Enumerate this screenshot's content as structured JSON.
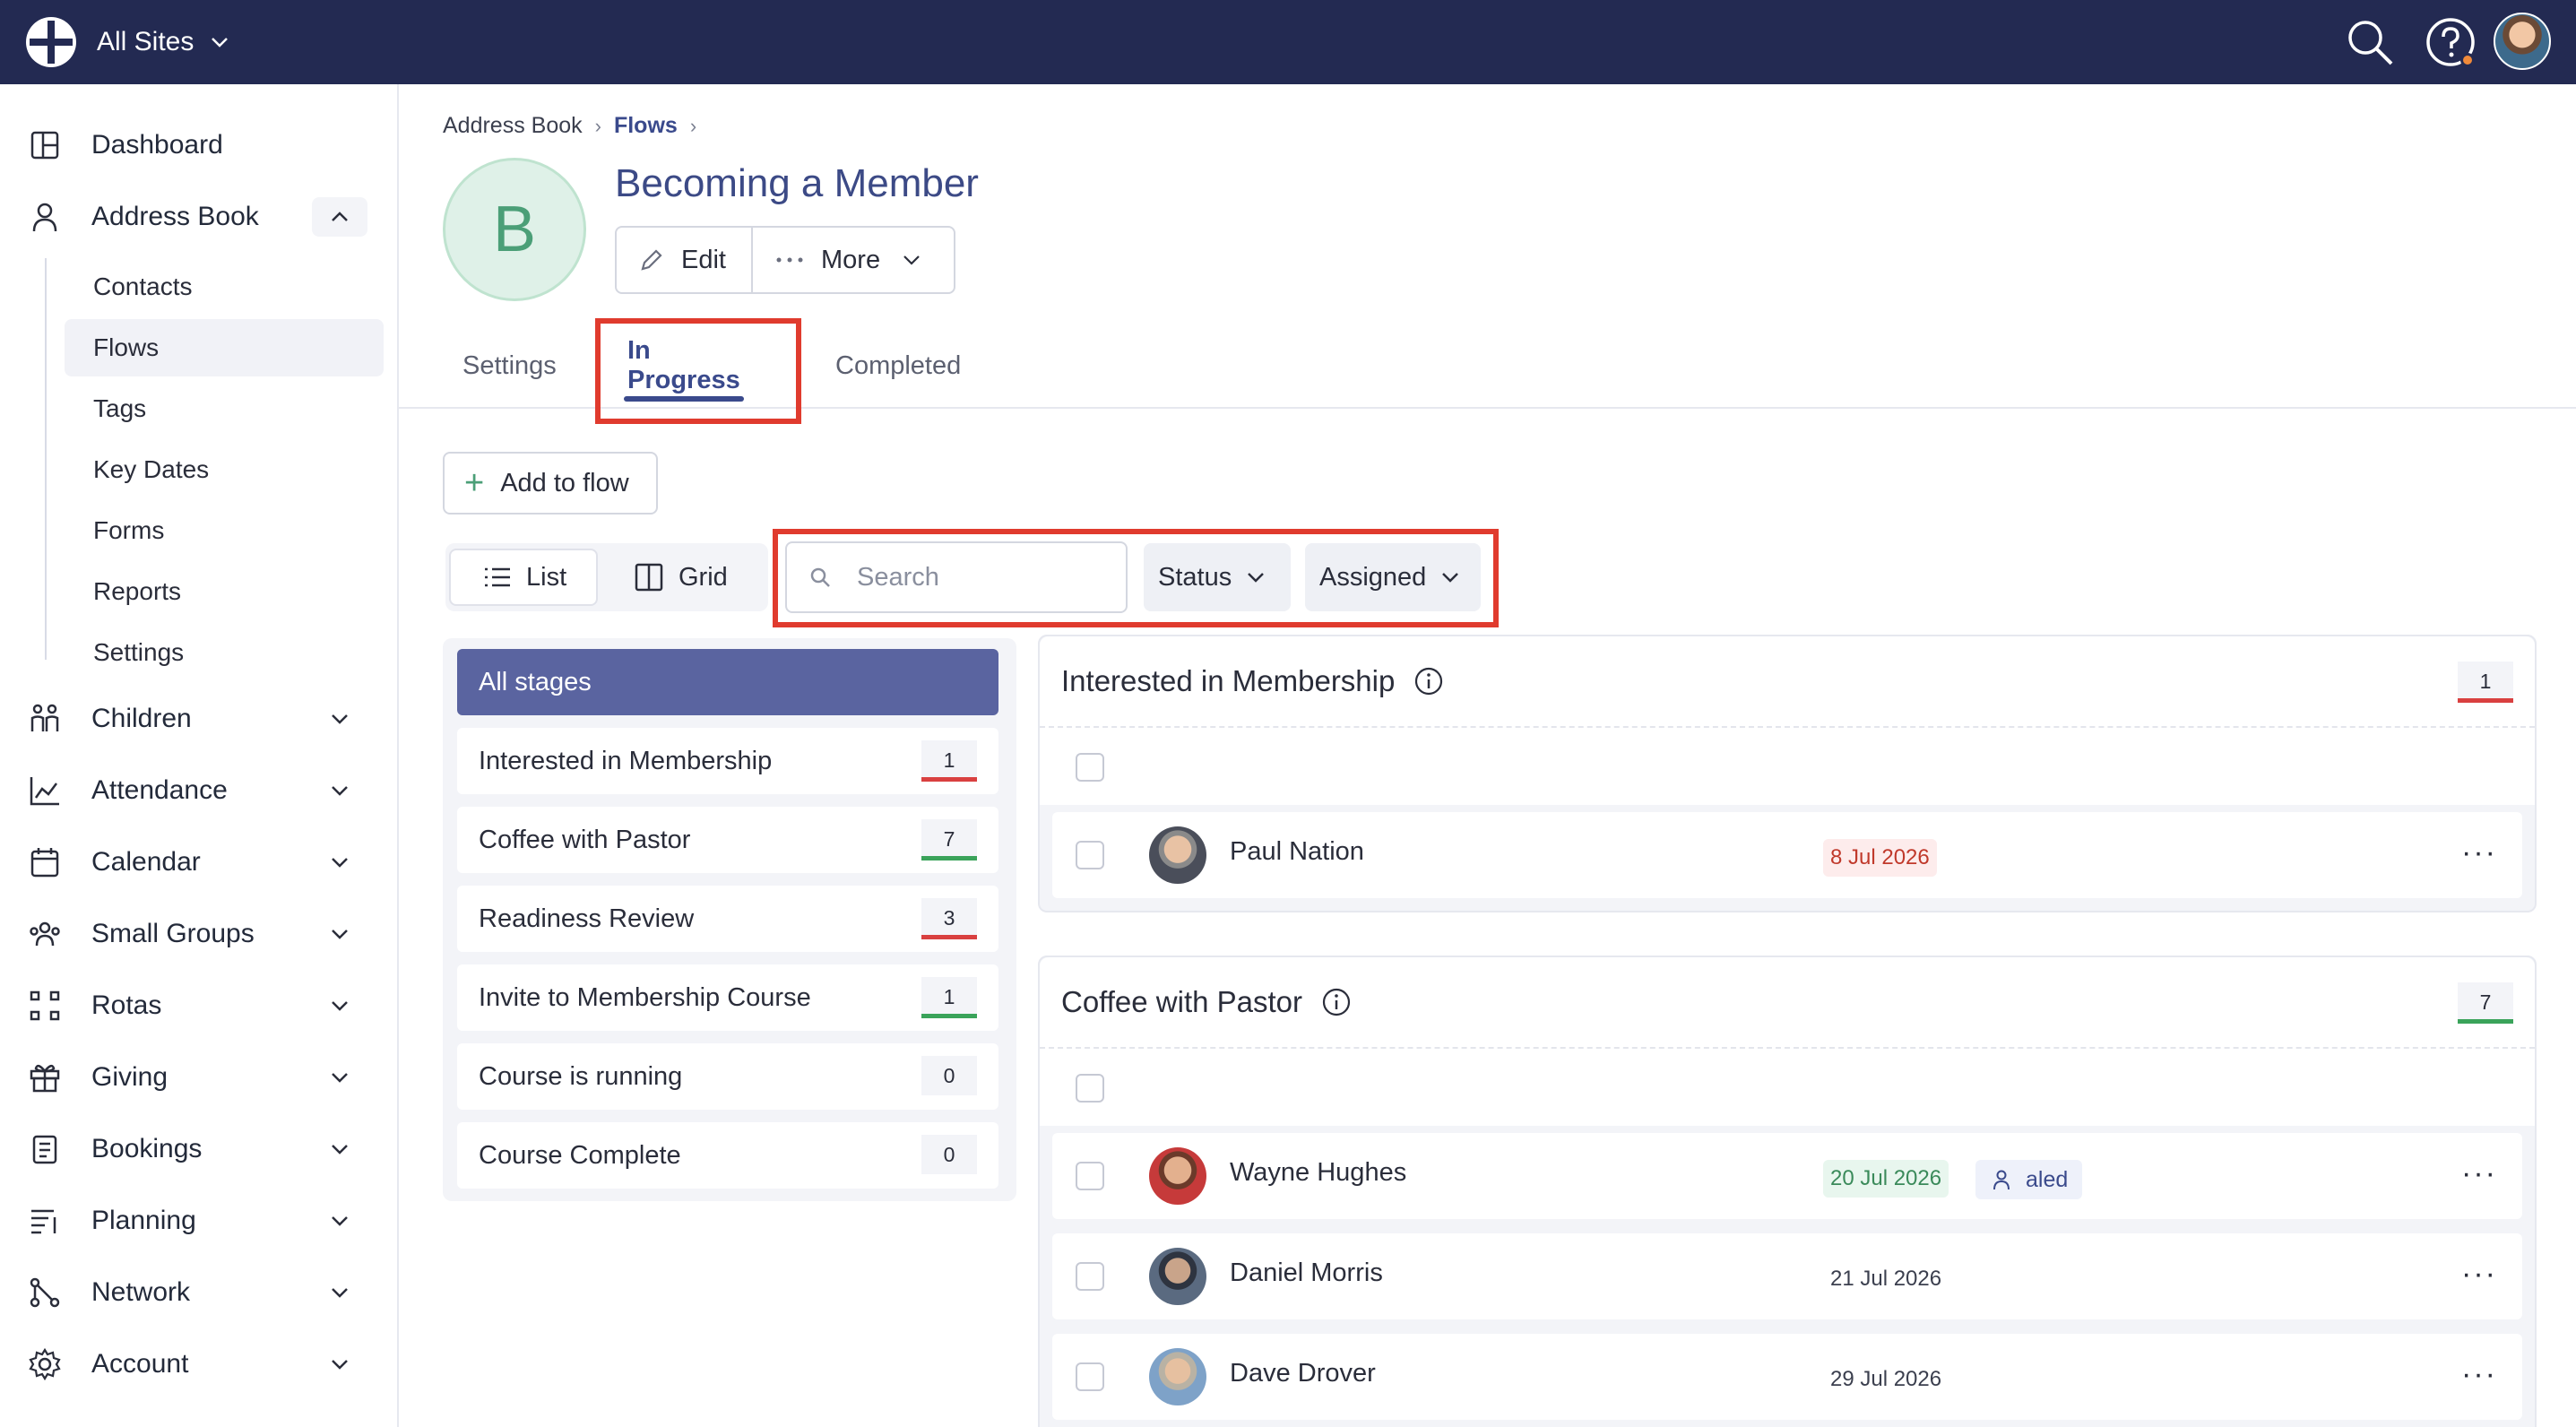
{
  "topbar": {
    "site_switch_label": "All Sites",
    "icons": [
      "globe-logo-icon",
      "chevron-down-icon",
      "search-icon",
      "help-icon",
      "user-avatar"
    ],
    "bg_color": "#232a52"
  },
  "sidebar": {
    "items": [
      {
        "label": "Dashboard",
        "icon": "dashboard-icon"
      },
      {
        "label": "Address Book",
        "icon": "person-icon",
        "expanded": true
      },
      {
        "label": "Children",
        "icon": "children-icon"
      },
      {
        "label": "Attendance",
        "icon": "chart-icon"
      },
      {
        "label": "Calendar",
        "icon": "calendar-icon"
      },
      {
        "label": "Small Groups",
        "icon": "group-icon"
      },
      {
        "label": "Rotas",
        "icon": "rotas-icon"
      },
      {
        "label": "Giving",
        "icon": "gift-icon"
      },
      {
        "label": "Bookings",
        "icon": "bookings-icon"
      },
      {
        "label": "Planning",
        "icon": "planning-icon"
      },
      {
        "label": "Network",
        "icon": "network-icon"
      },
      {
        "label": "Account",
        "icon": "gear-icon"
      }
    ],
    "address_book_sub": [
      "Contacts",
      "Flows",
      "Tags",
      "Key Dates",
      "Forms",
      "Reports",
      "Settings"
    ],
    "active_sub": "Flows"
  },
  "breadcrumb": {
    "root": "Address Book",
    "current": "Flows"
  },
  "flow": {
    "avatar_letter": "B",
    "title": "Becoming a Member",
    "edit_label": "Edit",
    "more_label": "More"
  },
  "tabs": [
    "Settings",
    "In Progress",
    "Completed"
  ],
  "active_tab": "In Progress",
  "toolbar": {
    "add_label": "Add to flow",
    "list_label": "List",
    "grid_label": "Grid",
    "search_placeholder": "Search",
    "status_label": "Status",
    "assigned_label": "Assigned"
  },
  "stages": [
    {
      "label": "All stages",
      "count": null
    },
    {
      "label": "Interested in Membership",
      "count": "1",
      "status_color": "#d94040"
    },
    {
      "label": "Coffee with Pastor",
      "count": "7",
      "status_color": "#3aa35a"
    },
    {
      "label": "Readiness Review",
      "count": "3",
      "status_color": "#d94040"
    },
    {
      "label": "Invite to Membership Course",
      "count": "1",
      "status_color": "#3aa35a"
    },
    {
      "label": "Course is running",
      "count": "0"
    },
    {
      "label": "Course Complete",
      "count": "0"
    }
  ],
  "groups": [
    {
      "title": "Interested in Membership",
      "count": "1",
      "status_color": "#d94040",
      "rows": [
        {
          "name": "Paul Nation",
          "date": "8 Jul 2026",
          "date_style": "overdue"
        }
      ]
    },
    {
      "title": "Coffee with Pastor",
      "count": "7",
      "status_color": "#3aa35a",
      "rows": [
        {
          "name": "Wayne Hughes",
          "date": "20 Jul 2026",
          "date_style": "upcoming",
          "assignee": "aled"
        },
        {
          "name": "Daniel Morris",
          "date": "21 Jul 2026",
          "date_style": "plain"
        },
        {
          "name": "Dave Drover",
          "date": "29 Jul 2026",
          "date_style": "plain"
        }
      ]
    }
  ],
  "colors": {
    "accent": "#3a4a8c",
    "highlight_box": "#e03b2e",
    "all_stages_bg": "#5a64a0"
  }
}
